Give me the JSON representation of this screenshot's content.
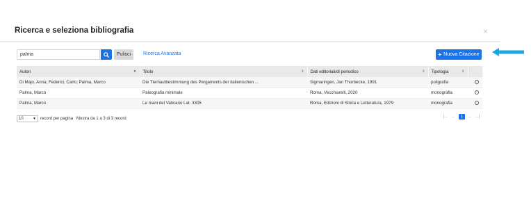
{
  "modal": {
    "title": "Ricerca e seleziona bibliografia",
    "close_symbol": "×"
  },
  "search": {
    "value": "palma",
    "clear_label": "Pulisci",
    "advanced_label": "Ricerca Avanzata"
  },
  "actions": {
    "new_label": "Nuova Citazione"
  },
  "table": {
    "headers": {
      "autori": "Autori",
      "titolo": "Titolo",
      "dati": "Dati editoriali/di periodico",
      "tipologia": "Tipologia"
    },
    "rows": [
      {
        "autori": "Di Majo, Anna; Federici, Carlo; Palma, Marco",
        "titolo": "Die Tierhautbestimmung des Pergaments der italienischen ...",
        "dati": "Sigmaringen, Jan Thorbecke, 1991",
        "tipologia": "poligrafia"
      },
      {
        "autori": "Palma, Marco",
        "titolo": "Paleografia minimale",
        "dati": "Roma, Vecchiarelli, 2020",
        "tipologia": "monografia"
      },
      {
        "autori": "Palma, Marco",
        "titolo": "Le mani del Vaticano Lat. 3305",
        "dati": "Roma, Edizioni di Storia e Letteratura, 1979",
        "tipologia": "monografia"
      }
    ]
  },
  "footer": {
    "per_page_value": "10",
    "per_page_label": "record per pagina",
    "info": "Mostra da 1 a 3 di 3 record"
  },
  "pager": {
    "first": "|←",
    "prev": "←",
    "current": "1",
    "next": "→",
    "last": "→|"
  },
  "colors": {
    "primary": "#1a73e8",
    "arrow": "#19a7e0",
    "header_bg": "#e9e9e9"
  }
}
